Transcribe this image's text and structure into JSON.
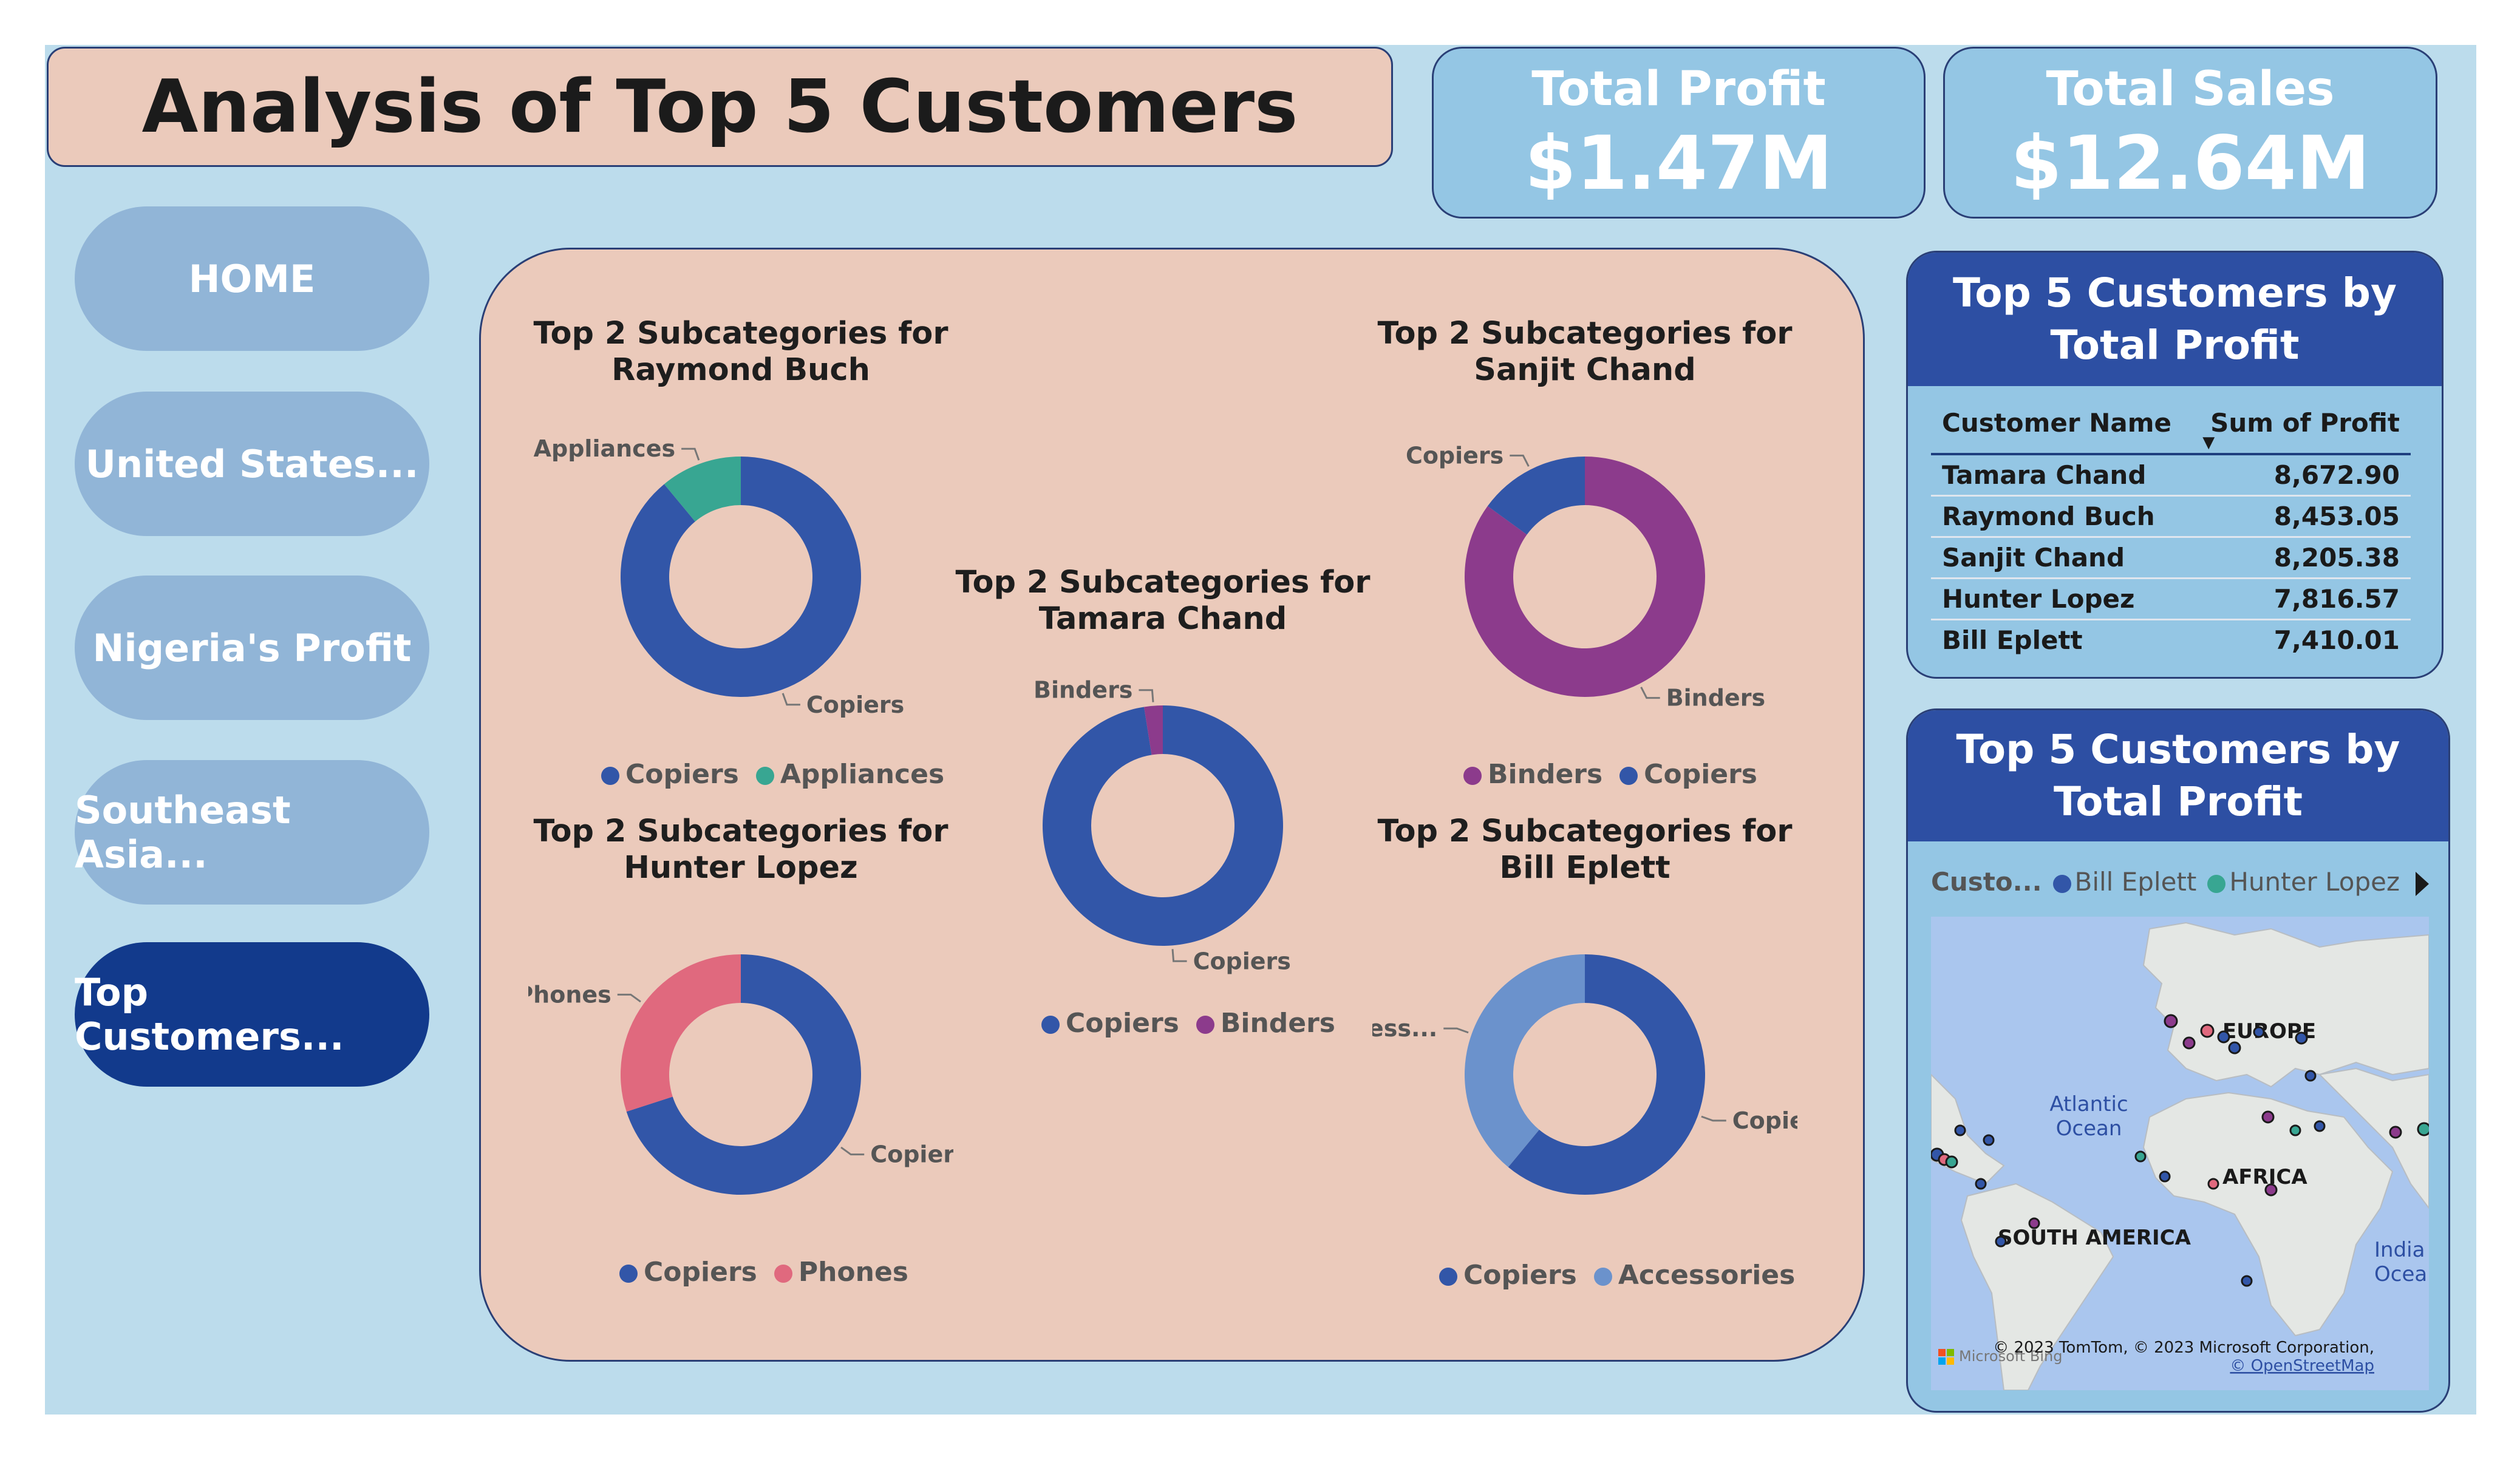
{
  "header": {
    "title": "Analysis of Top 5 Customers"
  },
  "kpis": {
    "profit": {
      "label": "Total Profit",
      "value": "$1.47M"
    },
    "sales": {
      "label": "Total Sales",
      "value": "$12.64M"
    }
  },
  "nav": {
    "items": [
      {
        "label": "HOME"
      },
      {
        "label": "United States..."
      },
      {
        "label": "Nigeria's Profit"
      },
      {
        "label": "Southeast Asia..."
      },
      {
        "label": "Top Customers..."
      }
    ],
    "active_index": 4
  },
  "colors": {
    "Copiers": "#3256a8",
    "Appliances": "#38a692",
    "Binders": "#8c3b8c",
    "Phones": "#e0697e",
    "Accessories": "#6b92cc"
  },
  "chart_data": [
    {
      "type": "pie",
      "title": "Top 2 Subcategories for Raymond Buch",
      "slices": [
        {
          "label": "Copiers",
          "fraction": 0.89
        },
        {
          "label": "Appliances",
          "fraction": 0.11
        }
      ],
      "legend": [
        "Copiers",
        "Appliances"
      ]
    },
    {
      "type": "pie",
      "title": "Top 2 Subcategories for Sanjit Chand",
      "slices": [
        {
          "label": "Binders",
          "fraction": 0.85
        },
        {
          "label": "Copiers",
          "fraction": 0.15
        }
      ],
      "legend": [
        "Binders",
        "Copiers"
      ]
    },
    {
      "type": "pie",
      "title": "Top 2 Subcategories for Tamara Chand",
      "slices": [
        {
          "label": "Copiers",
          "fraction": 0.975
        },
        {
          "label": "Binders",
          "fraction": 0.025
        }
      ],
      "legend": [
        "Copiers",
        "Binders"
      ]
    },
    {
      "type": "pie",
      "title": "Top 2 Subcategories for Hunter Lopez",
      "slices": [
        {
          "label": "Copiers",
          "fraction": 0.7
        },
        {
          "label": "Phones",
          "fraction": 0.3
        }
      ],
      "legend": [
        "Copiers",
        "Phones"
      ]
    },
    {
      "type": "pie",
      "title": "Top 2 Subcategories for Bill Eplett",
      "slices": [
        {
          "label": "Copiers",
          "fraction": 0.61
        },
        {
          "label": "Access...",
          "fraction": 0.39
        }
      ],
      "legend": [
        "Copiers",
        "Accessories"
      ]
    }
  ],
  "table_card": {
    "title": "Top 5 Customers by Total Profit",
    "columns": [
      "Customer Name",
      "Sum of Profit"
    ],
    "rows": [
      [
        "Tamara Chand",
        "8,672.90"
      ],
      [
        "Raymond Buch",
        "8,453.05"
      ],
      [
        "Sanjit Chand",
        "8,205.38"
      ],
      [
        "Hunter Lopez",
        "7,816.57"
      ],
      [
        "Bill Eplett",
        "7,410.01"
      ]
    ]
  },
  "map_card": {
    "title": "Top 5 Customers by Total Profit",
    "legend_title": "Custo...",
    "legend_items": [
      {
        "name": "Bill Eplett",
        "color": "#3256a8"
      },
      {
        "name": "Hunter Lopez",
        "color": "#38a692"
      }
    ],
    "labels": {
      "europe": "EUROPE",
      "atlantic": "Atlantic\nOcean",
      "africa": "AFRICA",
      "south_america": "SOUTH AMERICA",
      "india": "India\nOcea"
    },
    "copyright": "© 2023 TomTom, © 2023 Microsoft Corporation,",
    "osm": "© OpenStreetMap",
    "bing": "Microsoft Bing"
  }
}
